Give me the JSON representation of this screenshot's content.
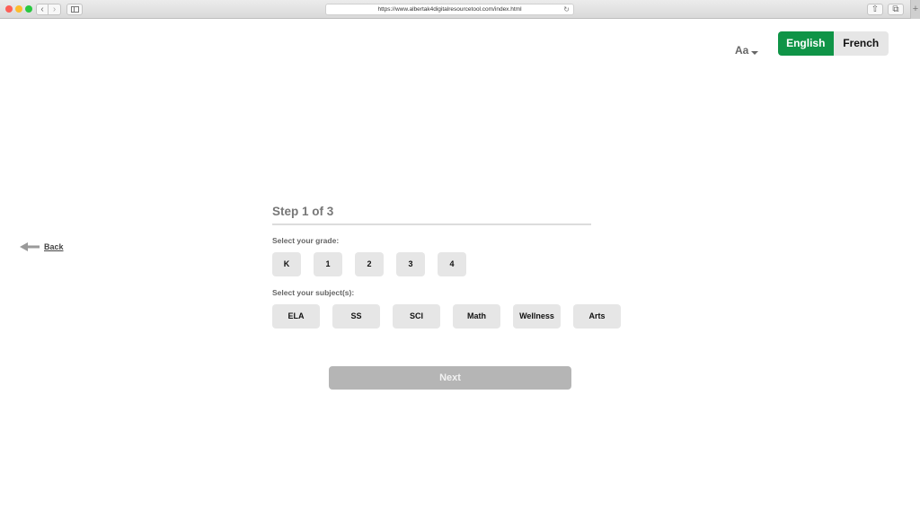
{
  "browser": {
    "url": "https://www.albertak4digitalresourcetool.com/index.html"
  },
  "controls": {
    "font_size_label": "Aa",
    "languages": [
      "English",
      "French"
    ],
    "active_language": "English",
    "back_label": "Back"
  },
  "wizard": {
    "step_title": "Step 1 of 3",
    "grade_label": "Select your grade:",
    "grades": [
      "K",
      "1",
      "2",
      "3",
      "4"
    ],
    "subject_label": "Select your subject(s):",
    "subjects": [
      "ELA",
      "SS",
      "SCI",
      "Math",
      "Wellness",
      "Arts"
    ],
    "next_label": "Next"
  },
  "colors": {
    "accent": "#0f9447",
    "button_bg": "#e6e6e6",
    "next_disabled": "#b5b5b5"
  }
}
